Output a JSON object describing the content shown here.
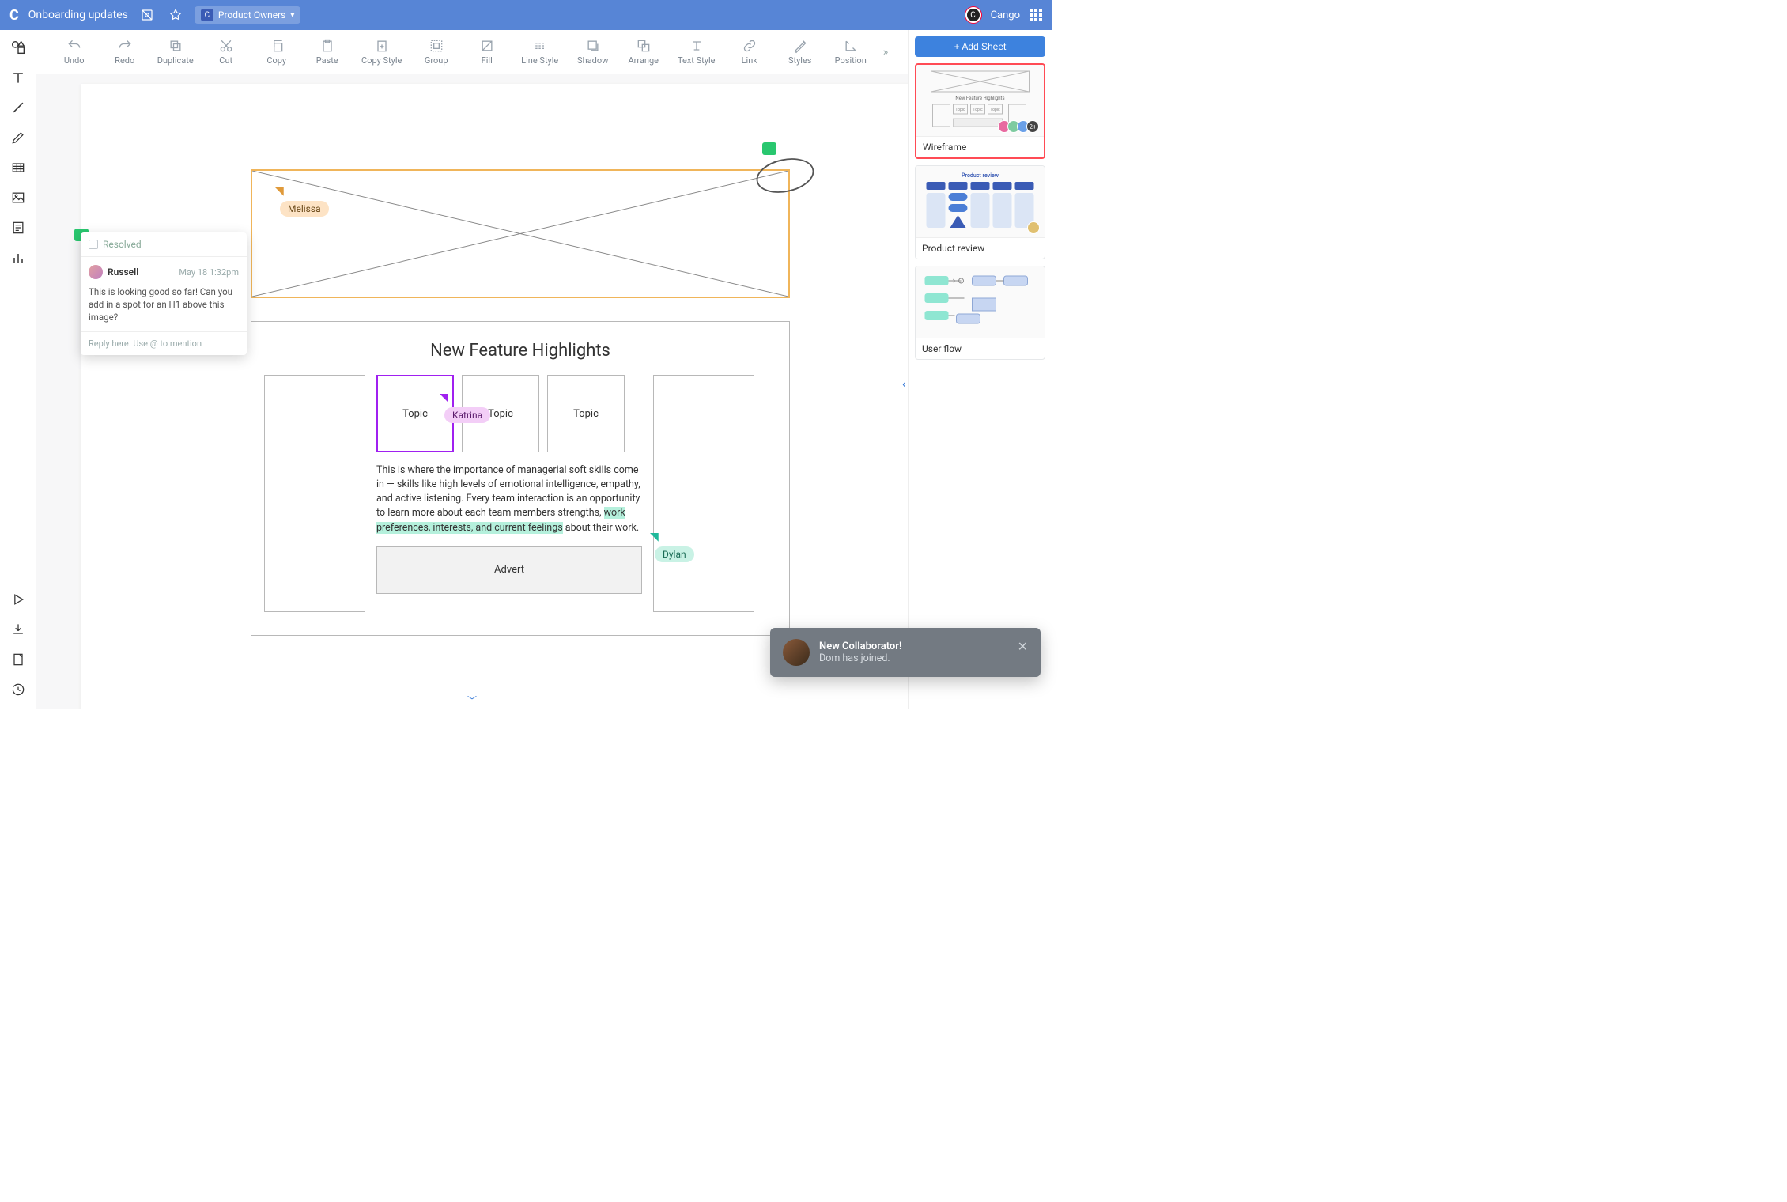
{
  "header": {
    "doc_title": "Onboarding updates",
    "team_label": "Product Owners",
    "brand_label": "Cango"
  },
  "toolbar": {
    "items": [
      "Undo",
      "Redo",
      "Duplicate",
      "Cut",
      "Copy",
      "Paste",
      "Copy Style",
      "Group",
      "Fill",
      "Line Style",
      "Shadow",
      "Arrange",
      "Text Style",
      "Link",
      "Styles",
      "Position"
    ]
  },
  "left_rail": {
    "top_tools": [
      "shapes",
      "text",
      "line",
      "pencil",
      "table",
      "image",
      "doc-lines",
      "bar-chart"
    ],
    "bottom_tools": [
      "play",
      "download",
      "page-setup",
      "history"
    ]
  },
  "canvas": {
    "wireframe_title": "New Feature Highlights",
    "topic_label": "Topic",
    "body_text_1": "This is where the importance of managerial soft skills come in — skills like high levels of emotional intelligence, empathy, and active listening. Every team interaction is an opportunity to learn more about each team members strengths, ",
    "body_highlight": "work preferences, interests, and current feelings",
    "body_text_2": " about their work.",
    "advert_label": "Advert"
  },
  "collaborators": {
    "melissa": "Melissa",
    "katrina": "Katrina",
    "dylan": "Dylan"
  },
  "comment": {
    "resolved_label": "Resolved",
    "author": "Russell",
    "timestamp": "May 18 1:32pm",
    "body": "This is looking good so far! Can you add in a spot for an H1 above this image?",
    "reply_placeholder": "Reply here. Use @ to mention"
  },
  "right_panel": {
    "add_label": "Add Sheet",
    "sheets": [
      {
        "name": "Wireframe",
        "active": true,
        "extra_count": "2+"
      },
      {
        "name": "Product review",
        "active": false
      },
      {
        "name": "User flow",
        "active": false
      }
    ]
  },
  "toast": {
    "title": "New Collaborator!",
    "subtitle": "Dom has joined."
  }
}
